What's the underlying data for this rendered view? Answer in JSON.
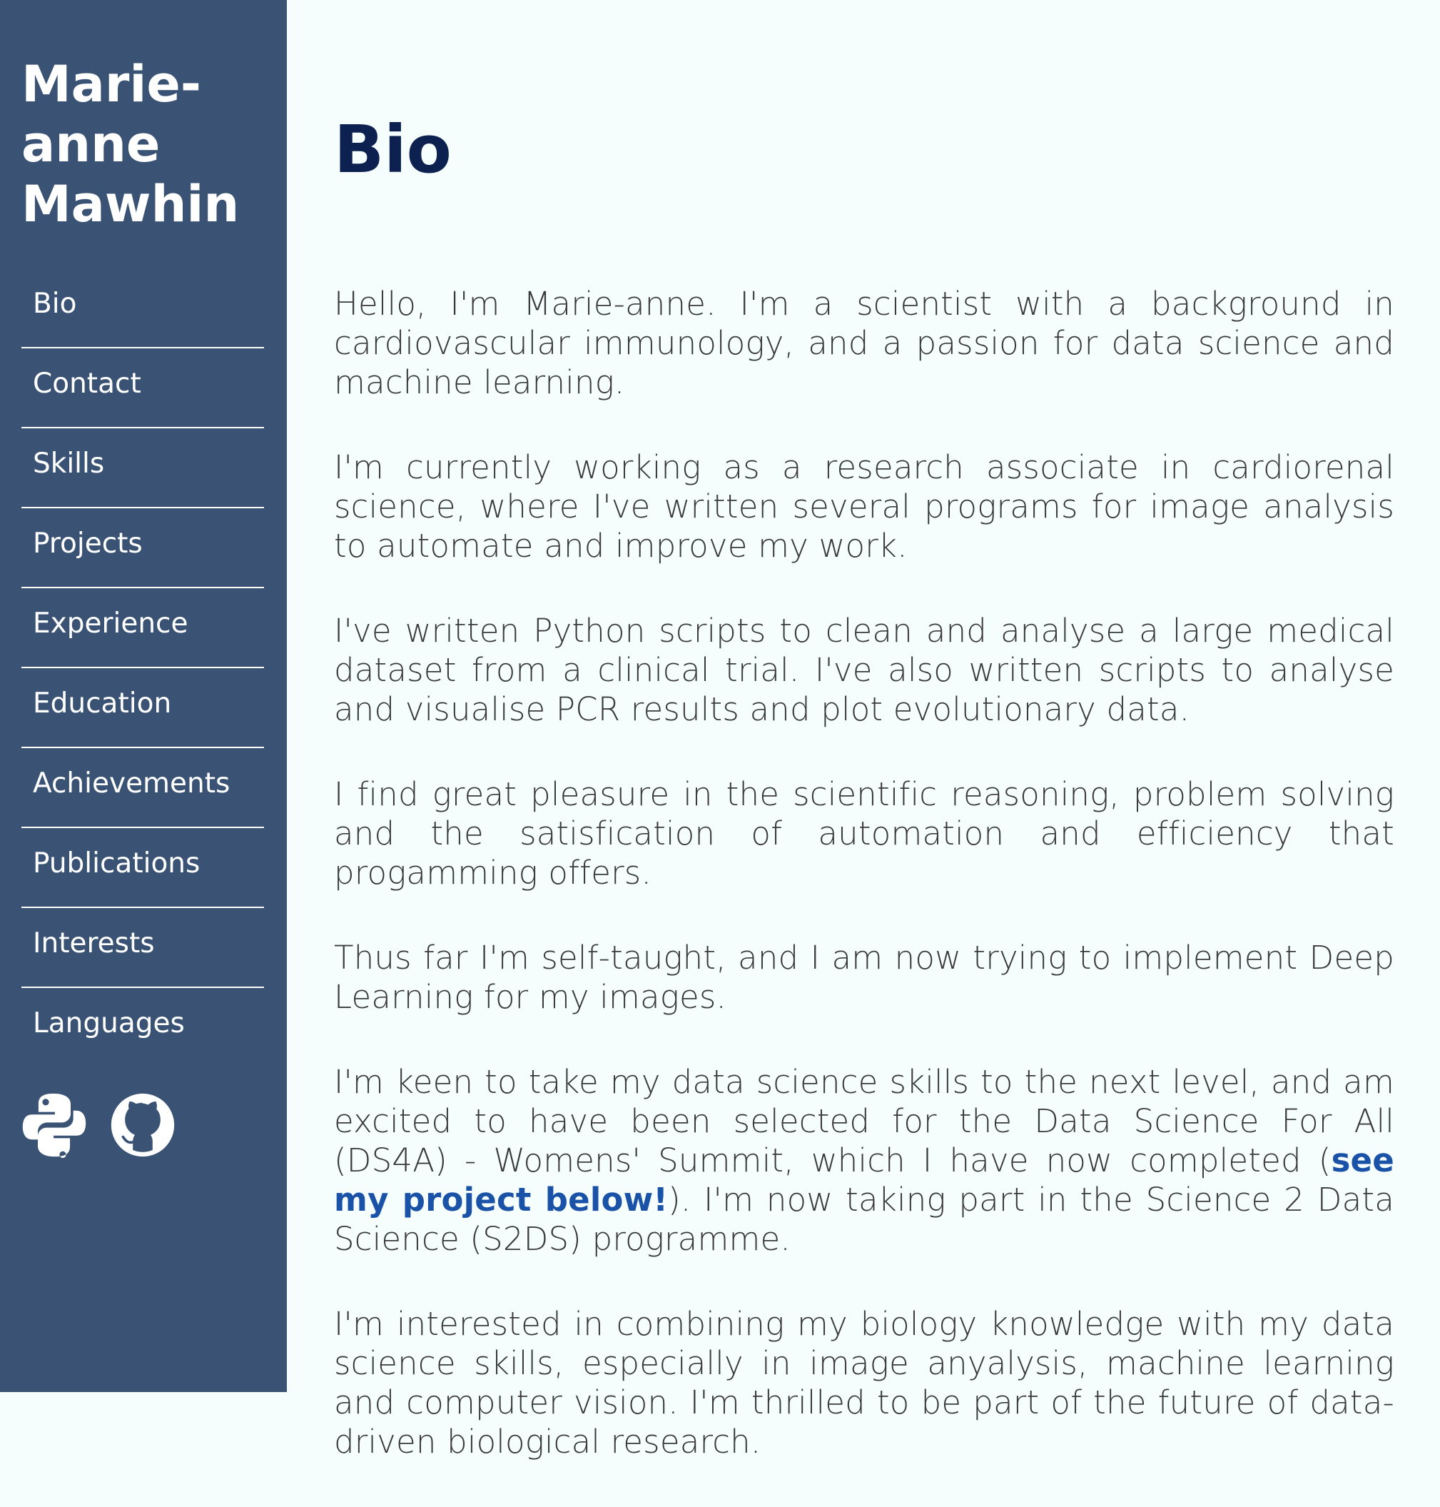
{
  "sidebar": {
    "title": "Marie-anne Mawhin",
    "nav": [
      {
        "label": "Bio"
      },
      {
        "label": "Contact"
      },
      {
        "label": "Skills"
      },
      {
        "label": "Projects"
      },
      {
        "label": "Experience"
      },
      {
        "label": "Education"
      },
      {
        "label": "Achievements"
      },
      {
        "label": "Publications"
      },
      {
        "label": "Interests"
      },
      {
        "label": "Languages"
      }
    ],
    "social_icons": [
      "python-icon",
      "github-icon"
    ]
  },
  "main": {
    "title": "Bio",
    "paragraphs": [
      "Hello, I'm Marie-anne. I'm a scientist with a background in cardiovascular immunology, and a passion for data science and machine learning.",
      "I'm currently working as a research associate in cardiorenal science, where I've written several programs for image analysis to automate and improve my work.",
      "I've written Python scripts to clean and analyse a large medical dataset from a clinical trial. I've also written scripts to analyse and visualise PCR results and plot evolutionary data.",
      "I find great pleasure in the scientific reasoning, problem solving and the satisfication of automation and efficiency that progamming offers.",
      "Thus far I'm self-taught, and I am now trying to implement Deep Learning for my images."
    ],
    "paragraph6": {
      "before": "I'm keen to take my data science skills to the next level, and am excited to have been selected for the Data Science For All (DS4A) - Womens' Summit, which I have now completed (",
      "link": "see my project below!",
      "after": "). I'm now taking part in the Science 2 Data Science (S2DS) programme."
    },
    "paragraph7": "I'm interested in combining my biology knowledge with my data science skills, especially in image anyalysis, machine learning and computer vision. I'm thrilled to be part of the future of data-driven biological research."
  },
  "colors": {
    "sidebar_bg": "#3a5375",
    "page_bg": "#f5fdfd",
    "title": "#0d2150",
    "body_text": "#3a3a3a",
    "link": "#1a52a8"
  }
}
